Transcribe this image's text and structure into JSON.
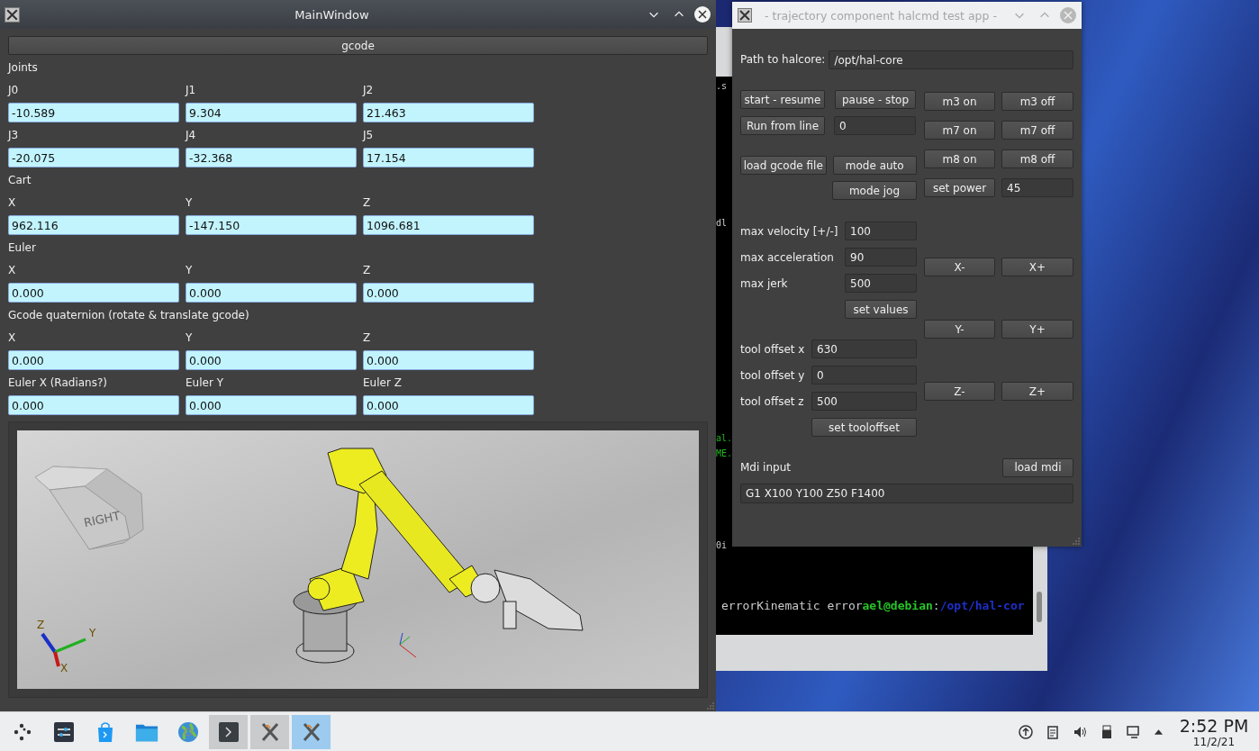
{
  "main_window": {
    "title": "MainWindow",
    "gcode_button": "gcode",
    "groups": [
      {
        "heading": "Joints",
        "rows": [
          [
            {
              "label": "J0",
              "value": "-10.589"
            },
            {
              "label": "J1",
              "value": "9.304"
            },
            {
              "label": "J2",
              "value": "21.463"
            }
          ],
          [
            {
              "label": "J3",
              "value": "-20.075"
            },
            {
              "label": "J4",
              "value": "-32.368"
            },
            {
              "label": "J5",
              "value": "17.154"
            }
          ]
        ]
      },
      {
        "heading": "Cart",
        "rows": [
          [
            {
              "label": "X",
              "value": "962.116"
            },
            {
              "label": "Y",
              "value": "-147.150"
            },
            {
              "label": "Z",
              "value": "1096.681"
            }
          ]
        ]
      },
      {
        "heading": "Euler",
        "rows": [
          [
            {
              "label": "X",
              "value": "0.000"
            },
            {
              "label": "Y",
              "value": "0.000"
            },
            {
              "label": "Z",
              "value": "0.000"
            }
          ]
        ]
      },
      {
        "heading": "Gcode quaternion (rotate & translate gcode)",
        "rows": [
          [
            {
              "label": "X",
              "value": "0.000"
            },
            {
              "label": "Y",
              "value": "0.000"
            },
            {
              "label": "Z",
              "value": "0.000"
            }
          ],
          [
            {
              "label": "Euler X (Radians?)",
              "value": "0.000"
            },
            {
              "label": "Euler Y",
              "value": "0.000"
            },
            {
              "label": "Euler Z",
              "value": "0.000"
            }
          ]
        ]
      }
    ],
    "viewer": {
      "view_cube_label": "RIGHT",
      "axis_labels": {
        "z": "Z",
        "y": "Y",
        "x": "X"
      }
    }
  },
  "terminal": {
    "fragments": [
      ".s",
      "dl",
      "al.",
      "ME.",
      "0i"
    ],
    "prompt_line": [
      {
        "kind": "output",
        "text": "errorKinematic error"
      },
      {
        "kind": "user",
        "text": "ael@debian"
      },
      {
        "kind": "separator",
        "text": ":"
      },
      {
        "kind": "path",
        "text": "/opt/hal-cor"
      }
    ]
  },
  "test_app": {
    "title": "- trajectory component halcmd test app -",
    "path": {
      "label": "Path to halcore:",
      "value": "/opt/hal-core"
    },
    "start_button": "start - resume",
    "pause_button": "pause - stop",
    "run_from_line": {
      "button": "Run from line",
      "value": "0"
    },
    "load_button": "load gcode file",
    "mode_auto_button": "mode auto",
    "mode_jog_button": "mode jog",
    "limits": [
      {
        "label": "max velocity [+/-]",
        "value": "100"
      },
      {
        "label": "max acceleration",
        "value": "90"
      },
      {
        "label": "max jerk",
        "value": "500"
      }
    ],
    "set_values_button": "set values",
    "tool_offsets": [
      {
        "label": "tool offset x",
        "value": "630"
      },
      {
        "label": "tool offset y",
        "value": "0"
      },
      {
        "label": "tool offset z",
        "value": "500"
      }
    ],
    "set_tooloffset_button": "set tooloffset",
    "m_buttons": [
      {
        "on": "m3 on",
        "off": "m3 off"
      },
      {
        "on": "m7 on",
        "off": "m7 off"
      },
      {
        "on": "m8 on",
        "off": "m8 off"
      }
    ],
    "power": {
      "button": "set power",
      "value": "45"
    },
    "jog_buttons": [
      {
        "minus": "X-",
        "plus": "X+"
      },
      {
        "minus": "Y-",
        "plus": "Y+"
      },
      {
        "minus": "Z-",
        "plus": "Z+"
      }
    ],
    "mdi": {
      "label": "Mdi input",
      "button": "load mdi",
      "value": "G1 X100 Y100 Z50 F1400"
    }
  },
  "taskbar": {
    "launchers": [
      {
        "kind": "launcher"
      },
      {
        "kind": "settings"
      },
      {
        "kind": "store"
      },
      {
        "kind": "files"
      },
      {
        "kind": "browser"
      }
    ],
    "tasks": [
      {
        "kind": "terminal",
        "selected": false
      },
      {
        "kind": "x-app",
        "selected": false
      },
      {
        "kind": "x-app",
        "selected": true
      }
    ],
    "time": "2:52 PM",
    "date": "11/2/21"
  }
}
